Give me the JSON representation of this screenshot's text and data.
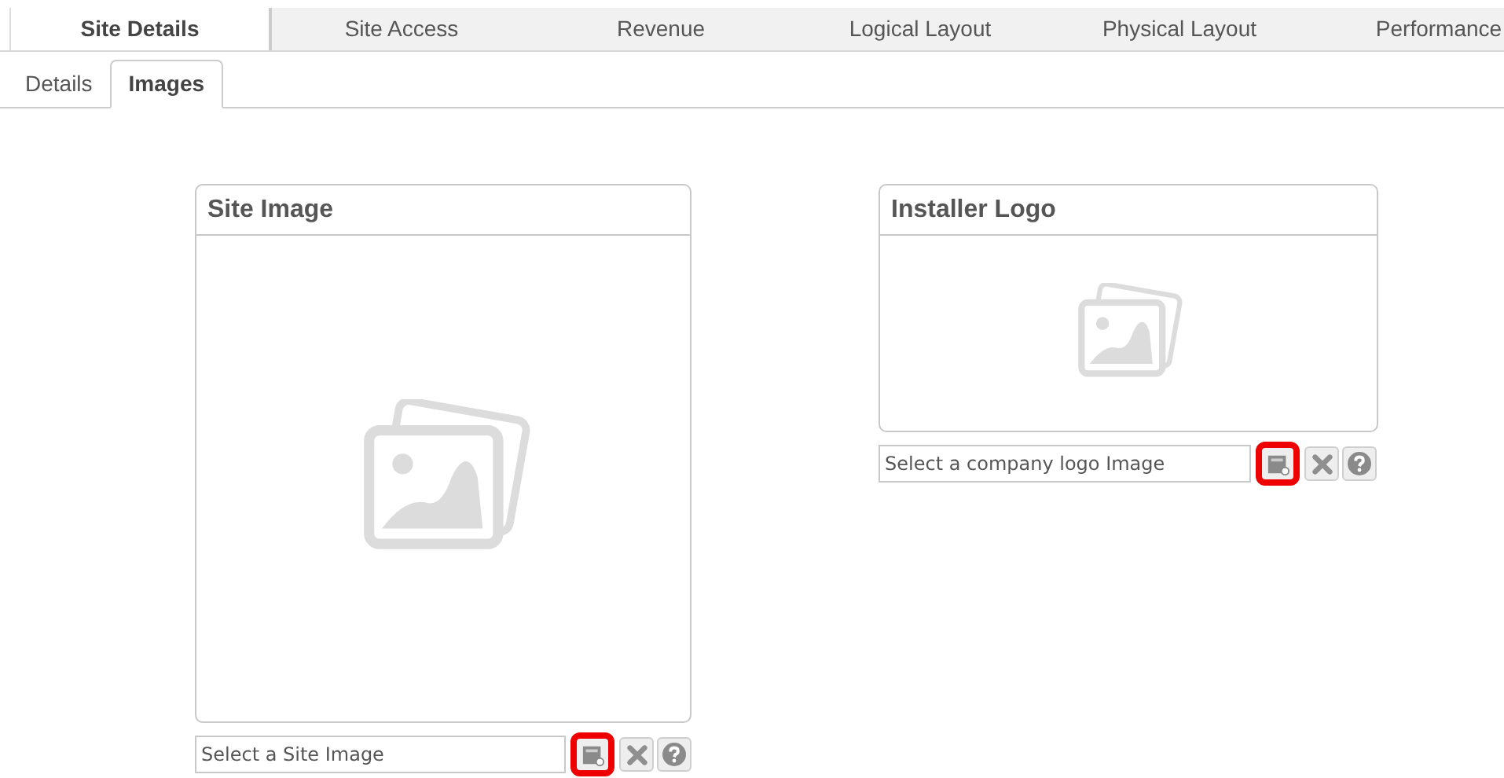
{
  "tabs": [
    {
      "label": "Site Details",
      "selected": true
    },
    {
      "label": "Site Access",
      "selected": false
    },
    {
      "label": "Revenue",
      "selected": false
    },
    {
      "label": "Logical Layout",
      "selected": false
    },
    {
      "label": "Physical Layout",
      "selected": false
    },
    {
      "label": "Performance",
      "selected": false
    }
  ],
  "subtabs": [
    {
      "label": "Details",
      "selected": false
    },
    {
      "label": "Images",
      "selected": true
    }
  ],
  "panels": [
    {
      "title": "Site Image",
      "kind": "large",
      "placeholder": "Select a Site Image",
      "buttons": [
        {
          "kind": "browse",
          "highlighted": true
        },
        {
          "kind": "clear",
          "highlighted": false
        },
        {
          "kind": "help",
          "highlighted": false
        }
      ]
    },
    {
      "title": "Installer Logo",
      "kind": "small",
      "placeholder": "Select a company logo Image",
      "buttons": [
        {
          "kind": "browse",
          "highlighted": true
        },
        {
          "kind": "clear",
          "highlighted": false
        },
        {
          "kind": "help",
          "highlighted": false
        }
      ]
    }
  ]
}
